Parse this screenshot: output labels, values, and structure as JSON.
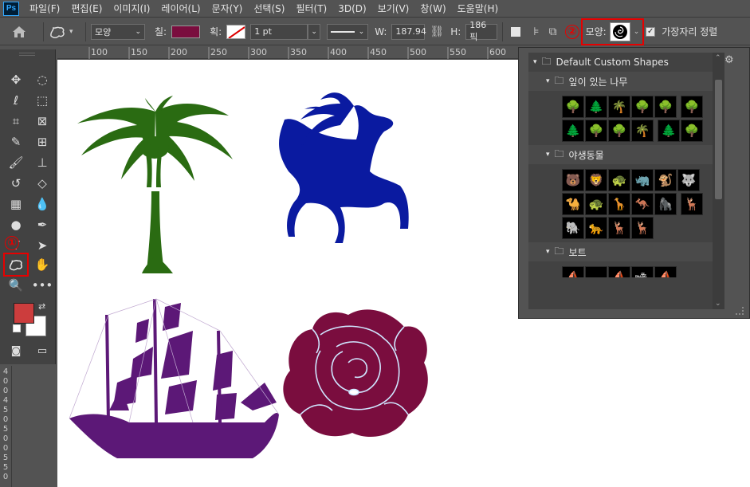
{
  "menubar": {
    "logo": "Ps",
    "items": [
      "파일(F)",
      "편집(E)",
      "이미지(I)",
      "레이어(L)",
      "문자(Y)",
      "선택(S)",
      "필터(T)",
      "3D(D)",
      "보기(V)",
      "창(W)",
      "도움말(H)"
    ]
  },
  "options": {
    "mode": "모양",
    "fill_label": "칠:",
    "fill_color": "#7a0d3e",
    "stroke_label": "획:",
    "stroke_width": "1 pt",
    "w_label": "W:",
    "w_value": "187.94",
    "h_label": "H:",
    "h_value": "186 픽",
    "shape_label": "모양:",
    "align_edges_label": "가장자리 정렬",
    "marker2": "②"
  },
  "ruler": {
    "top_ticks": [
      "100",
      "150",
      "200",
      "250",
      "300",
      "350",
      "400",
      "450",
      "500",
      "550",
      "600"
    ],
    "left_ticks": [
      "4",
      "0",
      "0",
      "4",
      "5",
      "0",
      "5",
      "0",
      "0",
      "5",
      "5",
      "0"
    ]
  },
  "toolbar": {
    "marker1": "①",
    "fg_color": "#cc3d3d",
    "bg_color": "#ffffff"
  },
  "shape_picker": {
    "root_folder": "Default Custom Shapes",
    "folders": [
      {
        "name": "잎이 있는 나무",
        "count": 12
      },
      {
        "name": "야생동물",
        "count": 15
      },
      {
        "name": "보트",
        "count": 5
      }
    ]
  },
  "canvas": {
    "palm_color": "#2a6b12",
    "deer_color": "#0a1aa0",
    "ship_color": "#5c1877",
    "rose_color": "#7a0d3e"
  }
}
